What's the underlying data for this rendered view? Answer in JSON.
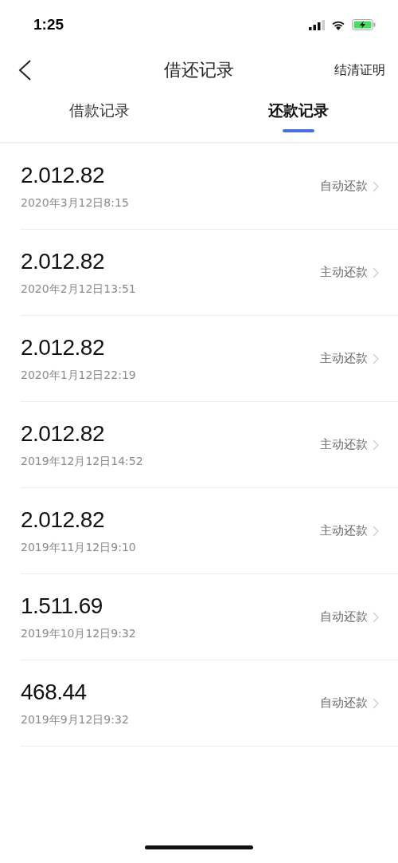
{
  "status_bar": {
    "time": "1:25"
  },
  "nav": {
    "title": "借还记录",
    "action": "结清证明"
  },
  "tabs": [
    {
      "label": "借款记录",
      "selected": false
    },
    {
      "label": "还款记录",
      "selected": true
    }
  ],
  "records": [
    {
      "amount": "2.012.82",
      "date": "2020年3月12日8:15",
      "type": "自动还款"
    },
    {
      "amount": "2.012.82",
      "date": "2020年2月12日13:51",
      "type": "主动还款"
    },
    {
      "amount": "2.012.82",
      "date": "2020年1月12日22:19",
      "type": "主动还款"
    },
    {
      "amount": "2.012.82",
      "date": "2019年12月12日14:52",
      "type": "主动还款"
    },
    {
      "amount": "2.012.82",
      "date": "2019年11月12日9:10",
      "type": "主动还款"
    },
    {
      "amount": "1.511.69",
      "date": "2019年10月12日9:32",
      "type": "自动还款"
    },
    {
      "amount": "468.44",
      "date": "2019年9月12日9:32",
      "type": "自动还款"
    }
  ]
}
